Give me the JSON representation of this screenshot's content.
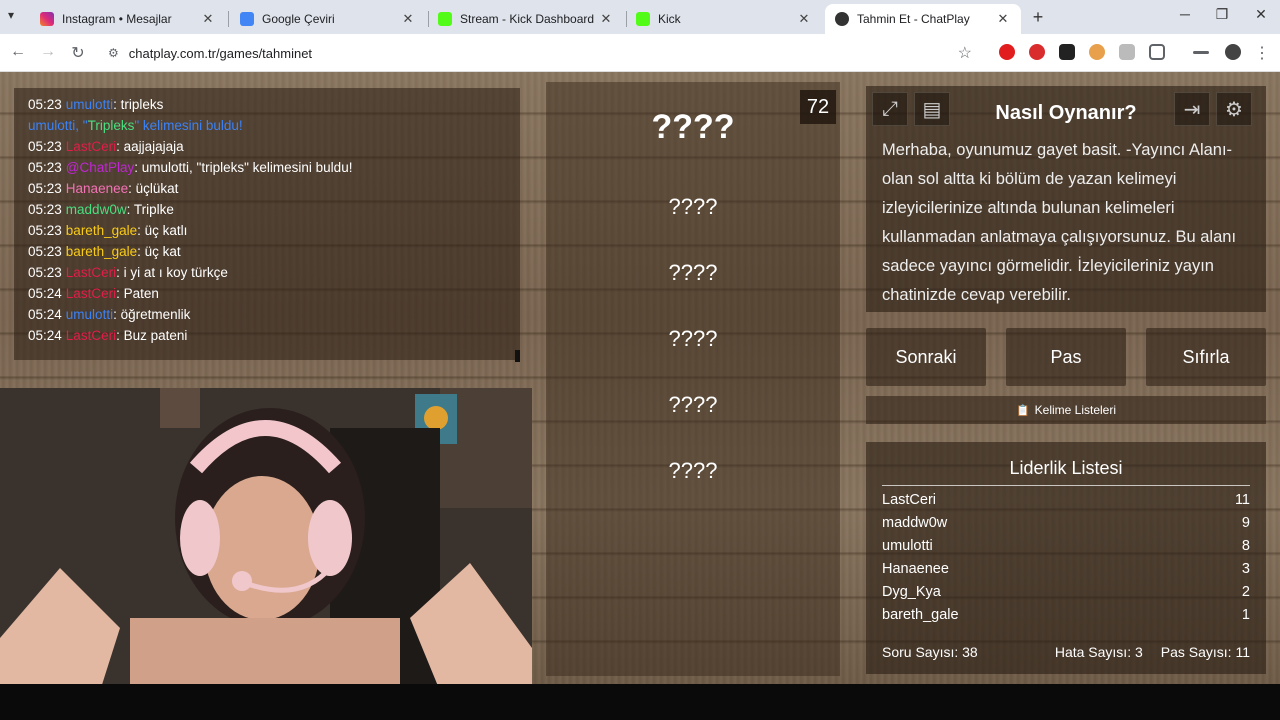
{
  "browser": {
    "tabs": [
      {
        "title": "Instagram • Mesajlar",
        "icon": "instagram-icon",
        "color": "#d6249f"
      },
      {
        "title": "Google Çeviri",
        "icon": "google-translate-icon",
        "color": "#4285f4"
      },
      {
        "title": "Stream - Kick Dashboard",
        "icon": "kick-icon",
        "color": "#53fc18"
      },
      {
        "title": "Kick",
        "icon": "kick-icon",
        "color": "#53fc18"
      },
      {
        "title": "Tahmin Et - ChatPlay",
        "icon": "chatplay-icon",
        "color": "#333333"
      }
    ],
    "url": "chatplay.com.tr/games/tahminet"
  },
  "chat": {
    "messages": [
      {
        "time": "05:23",
        "user": "umulotti",
        "color": "#3b82f6",
        "text": ": tripleks"
      },
      {
        "time": "",
        "user": "umulotti, \"",
        "color": "#3b82f6",
        "highlight": "Tripleks",
        "text": "\" kelimesini buldu!"
      },
      {
        "time": "05:23",
        "user": "LastCeri",
        "color": "#e11d48",
        "text": ": aajjajajaja"
      },
      {
        "time": "05:23",
        "user": "@ChatPlay",
        "color": "#c026d3",
        "text": ": umulotti, \"tripleks\" kelimesini buldu!"
      },
      {
        "time": "05:23",
        "user": "Hanaenee",
        "color": "#f472b6",
        "text": ": üçlükat"
      },
      {
        "time": "05:23",
        "user": "maddw0w",
        "color": "#4ade80",
        "text": ": Triplke"
      },
      {
        "time": "05:23",
        "user": "bareth_gale",
        "color": "#facc15",
        "text": ": üç katlı"
      },
      {
        "time": "05:23",
        "user": "bareth_gale",
        "color": "#facc15",
        "text": ": üç kat"
      },
      {
        "time": "05:23",
        "user": "LastCeri",
        "color": "#e11d48",
        "text": ": i yi at ı koy türkçe"
      },
      {
        "time": "05:24",
        "user": "LastCeri",
        "color": "#e11d48",
        "text": ": Paten"
      },
      {
        "time": "05:24",
        "user": "umulotti",
        "color": "#3b82f6",
        "text": ": öğretmenlik"
      },
      {
        "time": "05:24",
        "user": "LastCeri",
        "color": "#e11d48",
        "text": ": Buz pateni"
      }
    ]
  },
  "game": {
    "timer": "72",
    "main_word": "????",
    "forbidden_words": [
      "????",
      "????",
      "????",
      "????",
      "????"
    ]
  },
  "howto": {
    "title": "Nasıl Oynanır?",
    "text": "Merhaba, oyunumuz gayet basit. -Yayıncı Alanı- olan sol altta ki bölüm de yazan kelimeyi izleyicilerinize altında bulunan kelimeleri kullanmadan anlatmaya çalışıyorsunuz. Bu alanı sadece yayıncı görmelidir. İzleyicileriniz yayın chatinizde cevap verebilir."
  },
  "controls": {
    "next": "Sonraki",
    "pass": "Pas",
    "reset": "Sıfırla",
    "word_lists": "Kelime Listeleri"
  },
  "leaderboard": {
    "title": "Liderlik Listesi",
    "rows": [
      {
        "name": "LastCeri",
        "score": "11"
      },
      {
        "name": "maddw0w",
        "score": "9"
      },
      {
        "name": "umulotti",
        "score": "8"
      },
      {
        "name": "Hanaenee",
        "score": "3"
      },
      {
        "name": "Dyg_Kya",
        "score": "2"
      },
      {
        "name": "bareth_gale",
        "score": "1"
      }
    ],
    "questions": "Soru Sayısı: 38",
    "errors": "Hata Sayısı: 3",
    "passes": "Pas Sayısı: 11"
  }
}
